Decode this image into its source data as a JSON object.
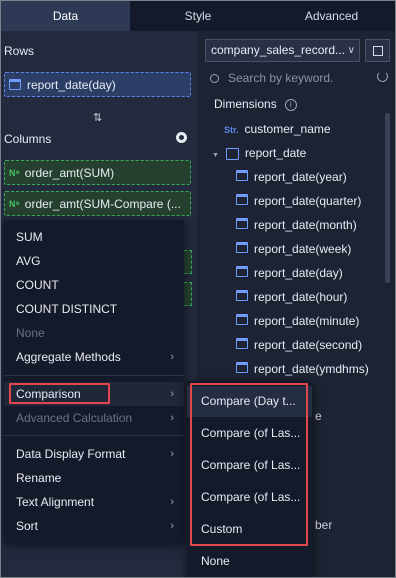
{
  "tabs": [
    {
      "label": "Data",
      "active": true
    },
    {
      "label": "Style",
      "active": false
    },
    {
      "label": "Advanced",
      "active": false
    }
  ],
  "rows": {
    "title": "Rows",
    "field": "report_date(day)"
  },
  "columns": {
    "title": "Columns",
    "fields": [
      {
        "badge": "N⁹",
        "label": "order_amt(SUM)"
      },
      {
        "badge": "N⁹",
        "label": "order_amt(SUM-Compare (..."
      }
    ]
  },
  "dataset": {
    "selected": "company_sales_record..."
  },
  "search": {
    "placeholder": "Search by keyword."
  },
  "dimensions": {
    "title": "Dimensions",
    "info_glyph": "i",
    "items": [
      {
        "badge": "Str.",
        "label": "customer_name"
      },
      {
        "label": "report_date",
        "expanded": true
      },
      {
        "label": "report_date(year)"
      },
      {
        "label": "report_date(quarter)"
      },
      {
        "label": "report_date(month)"
      },
      {
        "label": "report_date(week)"
      },
      {
        "label": "report_date(day)"
      },
      {
        "label": "report_date(hour)"
      },
      {
        "label": "report_date(minute)"
      },
      {
        "label": "report_date(second)"
      },
      {
        "label": "report_date(ymdhms)"
      }
    ],
    "partial_behind_1": "e",
    "partial_behind_2": "ber"
  },
  "menu": {
    "items": [
      {
        "label": "SUM",
        "disabled": false,
        "submenu": false
      },
      {
        "label": "AVG",
        "disabled": false,
        "submenu": false
      },
      {
        "label": "COUNT",
        "disabled": false,
        "submenu": false
      },
      {
        "label": "COUNT DISTINCT",
        "disabled": false,
        "submenu": false
      },
      {
        "label": "None",
        "disabled": true,
        "submenu": false
      },
      {
        "label": "Aggregate Methods",
        "disabled": false,
        "submenu": true
      },
      {
        "label": "Comparison",
        "disabled": false,
        "submenu": true,
        "highlighted": true
      },
      {
        "label": "Advanced Calculation",
        "disabled": true,
        "submenu": true
      },
      {
        "label": "Data Display Format",
        "disabled": false,
        "submenu": true
      },
      {
        "label": "Rename",
        "disabled": false,
        "submenu": false
      },
      {
        "label": "Text Alignment",
        "disabled": false,
        "submenu": true
      },
      {
        "label": "Sort",
        "disabled": false,
        "submenu": true
      }
    ],
    "arrow_glyph": "›"
  },
  "submenu": {
    "items": [
      {
        "label": "Compare (Day t...",
        "highlighted": true
      },
      {
        "label": "Compare (of Las..."
      },
      {
        "label": "Compare (of Las..."
      },
      {
        "label": "Compare (of Las..."
      },
      {
        "label": "Custom"
      },
      {
        "label": "None"
      }
    ]
  },
  "colors": {
    "highlight_border": "#e2474c",
    "date_field": "#5a86e8",
    "measure_field": "#3aa95a"
  }
}
